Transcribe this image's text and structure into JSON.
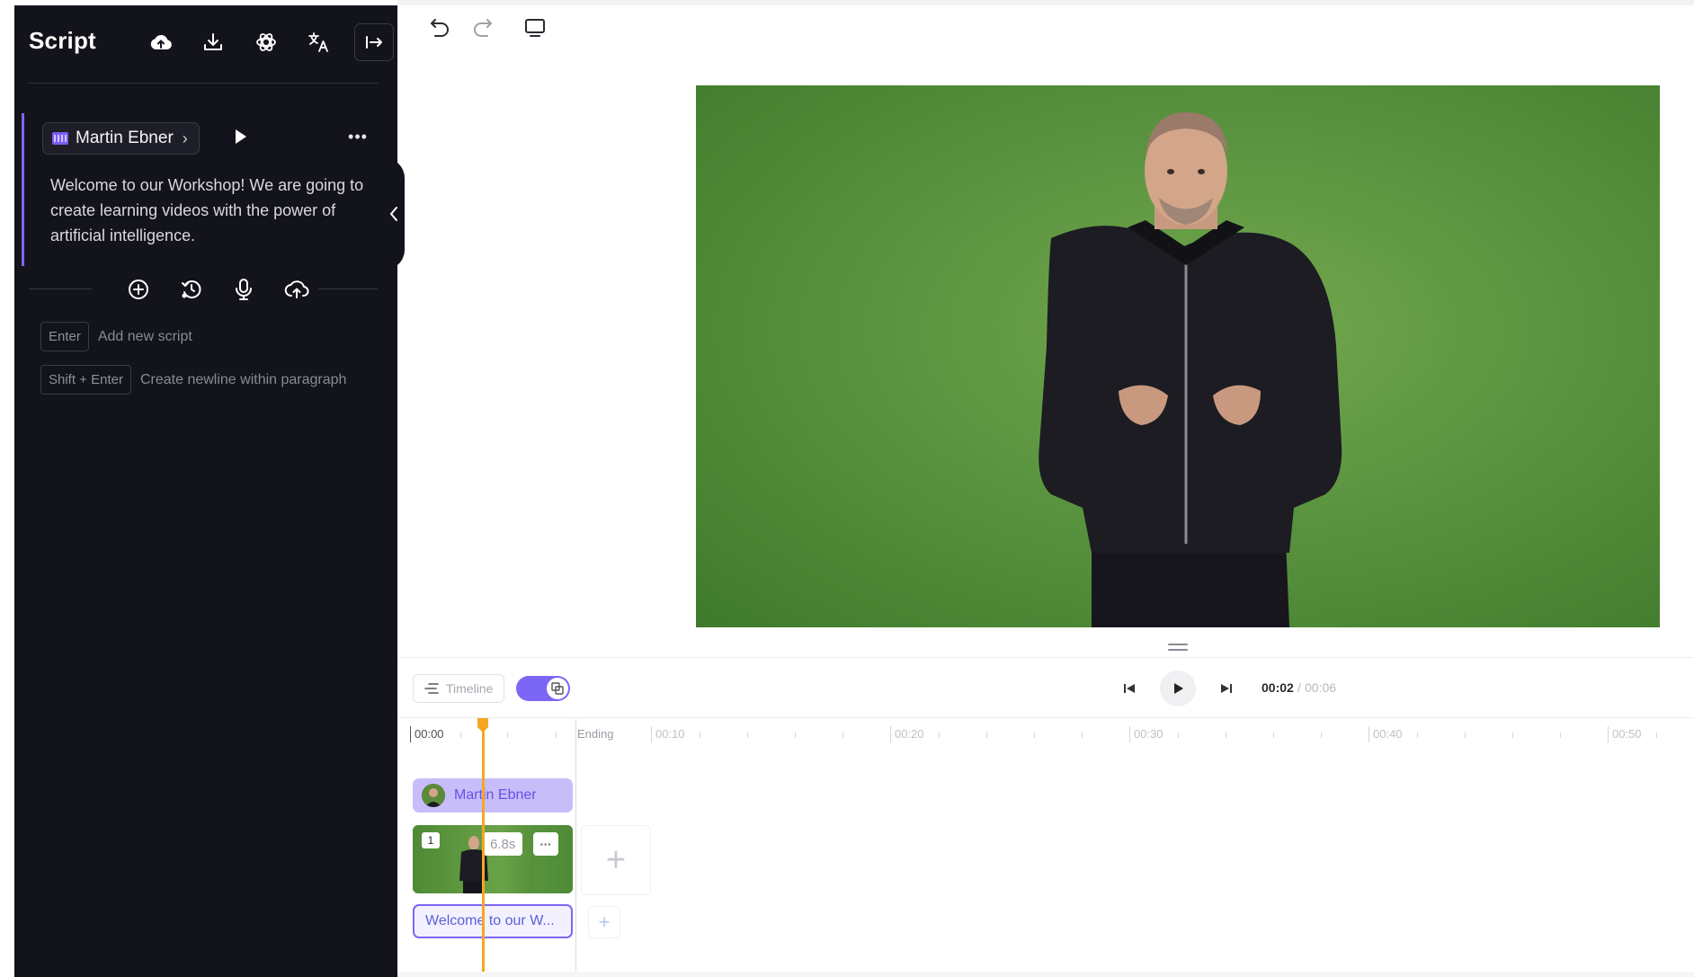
{
  "sidebar": {
    "title": "Script",
    "header_icons": [
      "cloud-upload-icon",
      "download-icon",
      "openai-icon",
      "translate-icon",
      "export-arrow-icon"
    ],
    "script": {
      "speaker": "Martin Ebner",
      "text": "Welcome to our Workshop! We are going to create learning videos with the power of artificial intelligence."
    },
    "tool_icons": [
      "add-circle-icon",
      "history-icon",
      "microphone-icon",
      "upload-cloud-icon"
    ],
    "hints": [
      {
        "key": "Enter",
        "label": "Add new script"
      },
      {
        "key": "Shift + Enter",
        "label": "Create newline within paragraph"
      }
    ]
  },
  "toolbar": {
    "icons": [
      "undo-icon",
      "redo-icon",
      "monitor-icon"
    ]
  },
  "timeline": {
    "toggle_label": "Timeline",
    "toggle_on": true,
    "current_time": "00:02",
    "separator": "/",
    "total_time": "00:06",
    "ruler": {
      "start": "00:00",
      "ending": "Ending",
      "marks": [
        "00:10",
        "00:20",
        "00:30",
        "00:40",
        "00:50"
      ]
    },
    "tracks": {
      "speaker": "Martin Ebner",
      "scene_index": "1",
      "scene_duration": "6.8s",
      "scene_more": "···",
      "add_scene": "+",
      "text": "Welcome to our W...",
      "add_text": "+"
    }
  },
  "colors": {
    "sidebar_bg": "#13131b",
    "accent": "#7b66f5",
    "playhead": "#f5a623",
    "greenscreen": "#5b9440"
  }
}
